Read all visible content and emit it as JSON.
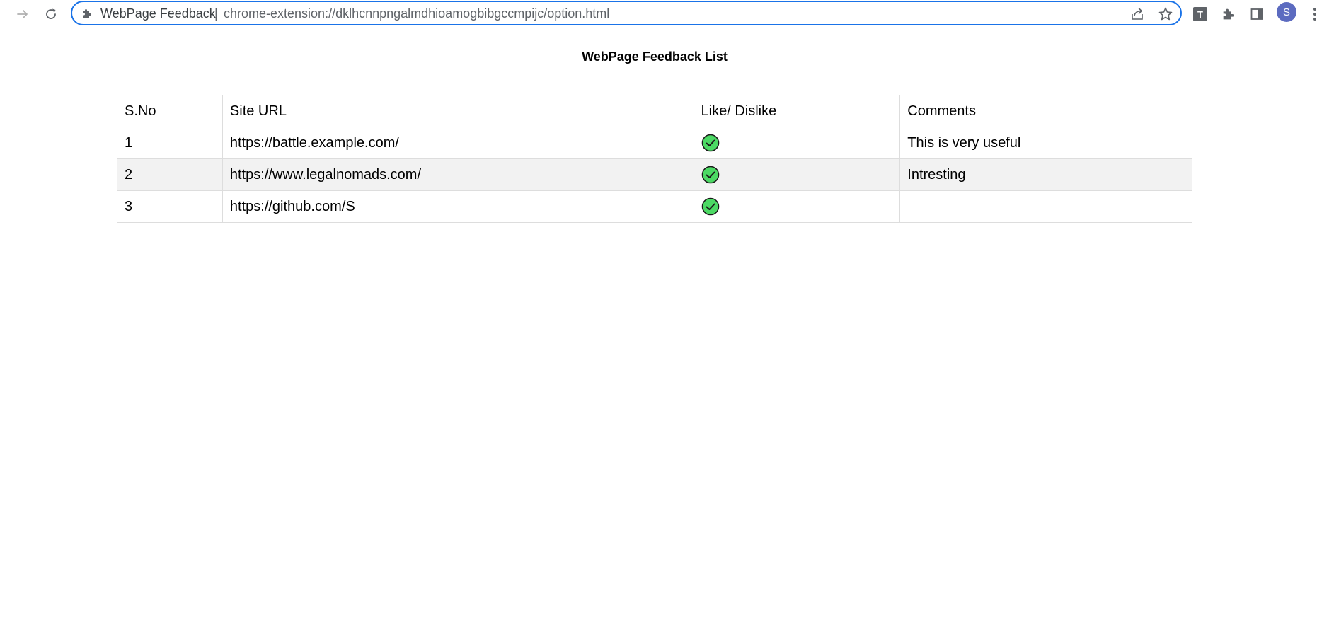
{
  "browser": {
    "site_name": "WebPage Feedback",
    "url": "chrome-extension://dklhcnnpngalmdhioamogbibgccmpijc/option.html",
    "separator": "|",
    "profile_initial": "S",
    "extension_badge": "T",
    "accent_color": "#1a73e8"
  },
  "page": {
    "title": "WebPage Feedback List"
  },
  "table": {
    "headers": [
      "S.No",
      "Site URL",
      "Like/ Dislike",
      "Comments"
    ],
    "rows": [
      {
        "sno": "1",
        "url": "https://battle.example.com/",
        "feedback": "like",
        "comment": "This is very useful"
      },
      {
        "sno": "2",
        "url": "https://www.legalnomads.com/",
        "feedback": "like",
        "comment": "Intresting"
      },
      {
        "sno": "3",
        "url": "https://github.com/S",
        "feedback": "like",
        "comment": ""
      }
    ],
    "like_icon": "green-check-circle-icon",
    "like_color": "#4cd964"
  }
}
